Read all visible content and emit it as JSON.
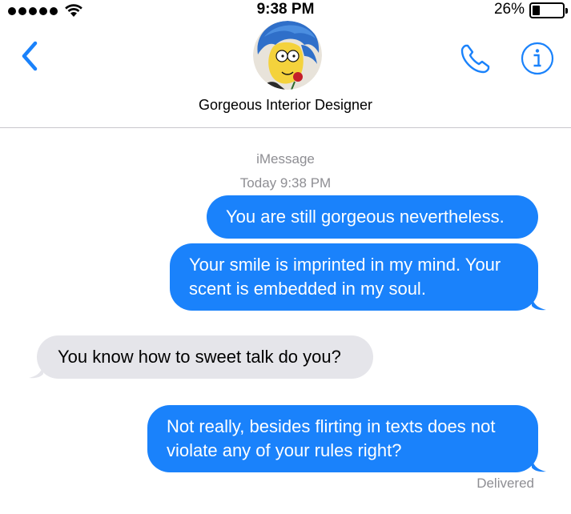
{
  "status_bar": {
    "time": "9:38 PM",
    "battery_percent": "26%",
    "battery_level": 0.26,
    "signal_bars": 5,
    "icons": [
      "signal-dots",
      "wifi-icon",
      "battery-icon"
    ]
  },
  "header": {
    "contact_name": "Gorgeous Interior Designer",
    "icons": [
      "back-chevron-icon",
      "phone-icon",
      "info-icon"
    ],
    "accent_color": "#1a82fb"
  },
  "thread": {
    "service": "iMessage",
    "timestamp": "Today 9:38 PM",
    "delivered": "Delivered",
    "messages": [
      {
        "direction": "sent",
        "text": "You are still gorgeous nevertheless."
      },
      {
        "direction": "sent",
        "text": "Your smile is imprinted in my mind. Your scent is embedded in my soul."
      },
      {
        "direction": "received",
        "text": "You know how to sweet talk do you?"
      },
      {
        "direction": "sent",
        "text": "Not really, besides flirting in texts does not violate any of your rules right?"
      }
    ]
  },
  "colors": {
    "sent_bubble": "#1a82fb",
    "received_bubble": "#e5e5ea",
    "meta_text": "#8e8e93"
  }
}
